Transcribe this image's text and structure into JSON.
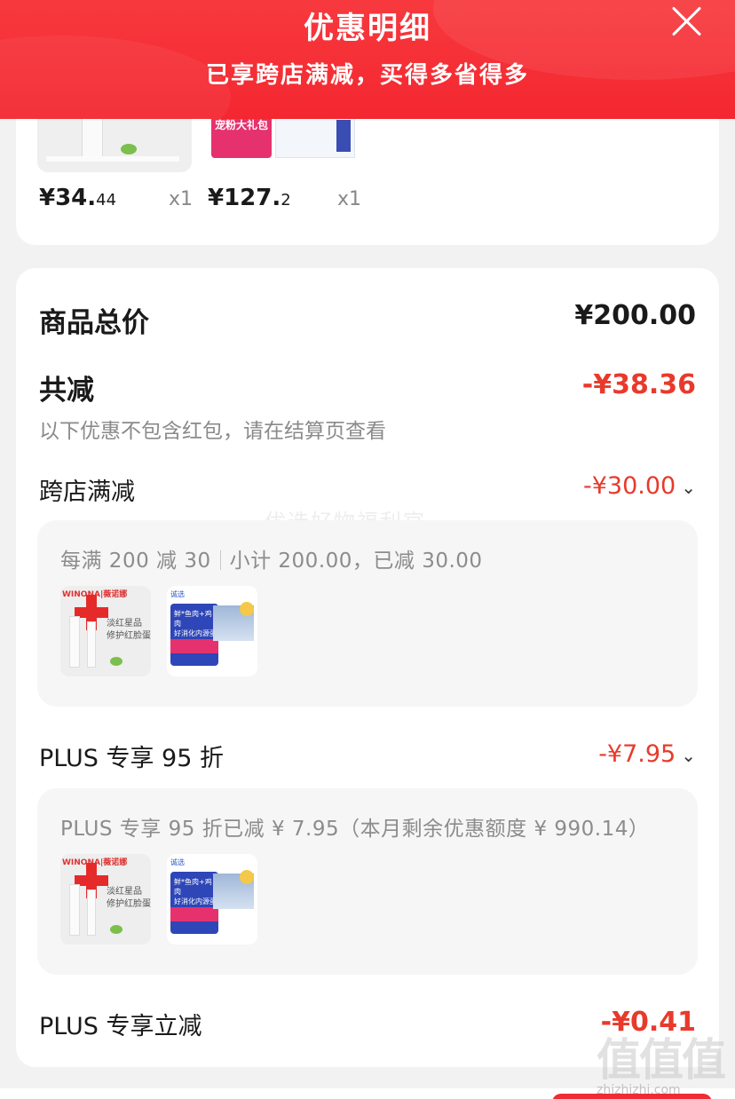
{
  "header": {
    "title": "优惠明细",
    "subtitle": "已享跨店满减，买得多省得多"
  },
  "products": [
    {
      "price_main": "¥34.",
      "price_cents": "44",
      "qty": "x1",
      "pack_label": ""
    },
    {
      "price_main": "¥127.",
      "price_cents": "2",
      "qty": "x1",
      "pack_label": "宠粉大礼包"
    }
  ],
  "summary": {
    "total_label": "商品总价",
    "total_value": "¥200.00",
    "discount_label": "共减",
    "discount_value": "-¥38.36",
    "note": "以下优惠不包含红包，请在结算页查看"
  },
  "promo_cross_store": {
    "label": "跨店满减",
    "value": "-¥30.00",
    "detail_rule": "每满 200 减 30",
    "detail_subtotal": "小计 200.00，已减 30.00",
    "thumb_a_brand": "WINONA|薇诺娜",
    "thumb_a_text": "淡红星品\n修护红脸蛋",
    "thumb_b_tag": "诚选",
    "thumb_b_text": "鲜*鱼肉+鸡肉\n好消化内源蛋白"
  },
  "promo_plus_discount": {
    "label": "PLUS 专享 95 折",
    "value": "-¥7.95",
    "detail": "PLUS 专享 95 折已减 ¥ 7.95（本月剩余优惠额度 ¥ 990.14）"
  },
  "promo_plus_instant": {
    "label": "PLUS 专享立减",
    "value": "-¥0.41"
  },
  "overlay_watermark": "优选好物福利官",
  "site_watermark": {
    "glyphs": "值值值",
    "url": "zhizhizhi.com"
  },
  "colors": {
    "header_red": "#f42730",
    "discount_red": "#e83a2c",
    "card_bg": "#ffffff",
    "page_bg": "#f2f2f2"
  },
  "icons": [
    "close-icon",
    "chevron-down-icon"
  ]
}
